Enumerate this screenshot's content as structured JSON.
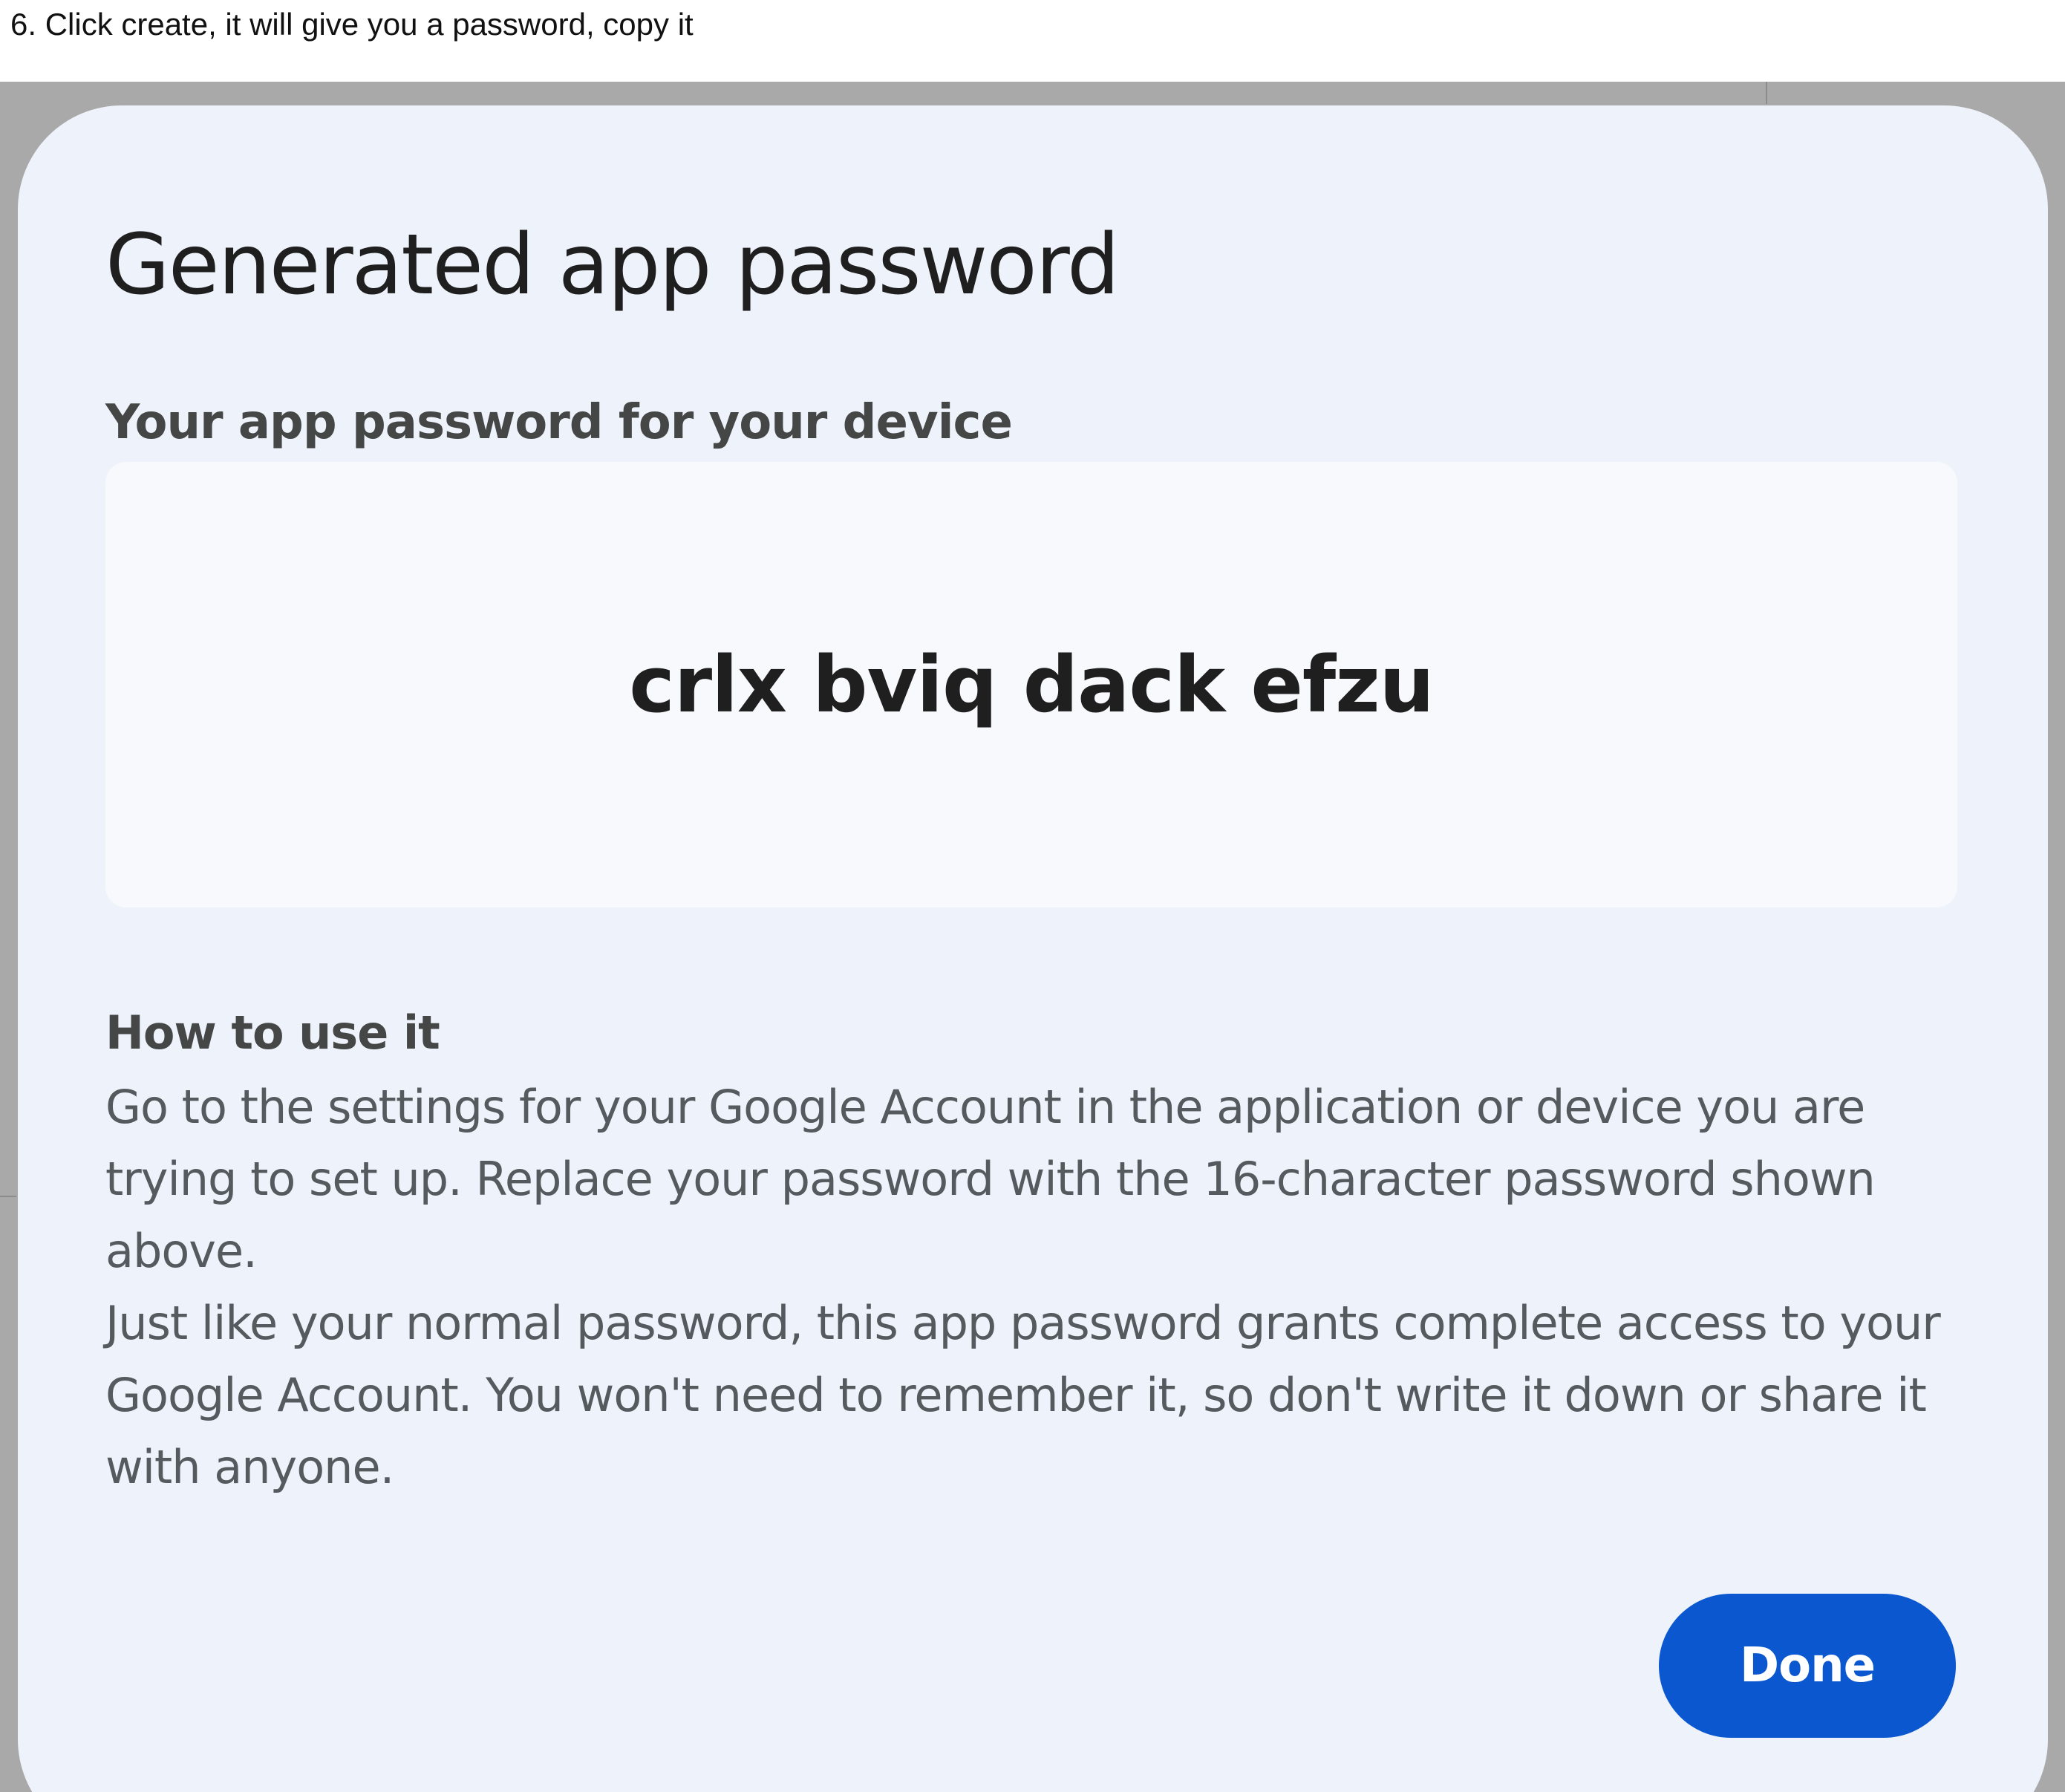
{
  "instruction": {
    "text": "6.  Click create, it will give you a password, copy it"
  },
  "dialog": {
    "title": "Generated app password",
    "subtitle": "Your app password for your device",
    "password": "crlx bviq dack efzu",
    "how_to": {
      "heading": "How to use it",
      "paragraph_1": "Go to the settings for your Google Account in the application or device you are trying to set up. Replace your password with the 16-character password shown above.",
      "paragraph_2": "Just like your normal password, this app password grants complete access to your Google Account. You won't need to remember it, so don't write it down or share it with anyone."
    },
    "done_label": "Done"
  },
  "colors": {
    "dialog_background": "#eef2fa",
    "password_box_background": "#f7f9fd",
    "primary_button": "#0b57d0",
    "frame_backdrop": "#a9a9a9"
  }
}
